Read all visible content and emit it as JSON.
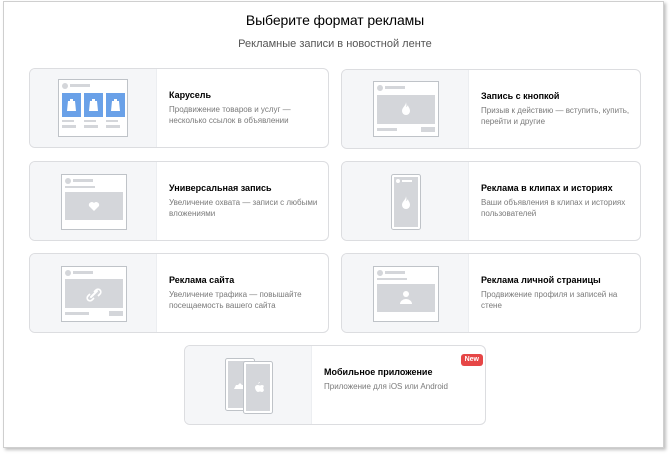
{
  "header": {
    "title": "Выберите формат рекламы",
    "subtitle": "Рекламные записи в новостной ленте"
  },
  "cards": [
    {
      "name": "Карусель",
      "desc": "Продвижение товаров и услуг — несколько ссылок в объявлении",
      "icon": "carousel-icon"
    },
    {
      "name": "Запись с кнопкой",
      "desc": "Призыв к действию — вступить, купить, перейти и другие",
      "icon": "fire-icon"
    },
    {
      "name": "Универсальная запись",
      "desc": "Увеличение охвата — записи с любыми вложениями",
      "icon": "heart-icon"
    },
    {
      "name": "Реклама в клипах и историях",
      "desc": "Ваши объявления в клипах и историях пользователей",
      "icon": "fire-icon"
    },
    {
      "name": "Реклама сайта",
      "desc": "Увеличение трафика — повышайте посещаемость вашего сайта",
      "icon": "link-icon"
    },
    {
      "name": "Реклама личной страницы",
      "desc": "Продвижение профиля и записей на стене",
      "icon": "person-icon"
    },
    {
      "name": "Мобильное приложение",
      "desc": "Приложение для iOS или Android",
      "icon": "apple-icon",
      "badge": "New"
    }
  ],
  "colors": {
    "badge": "#e64646",
    "placeholder": "#d4d6da",
    "accent": "#6aa1e8"
  }
}
